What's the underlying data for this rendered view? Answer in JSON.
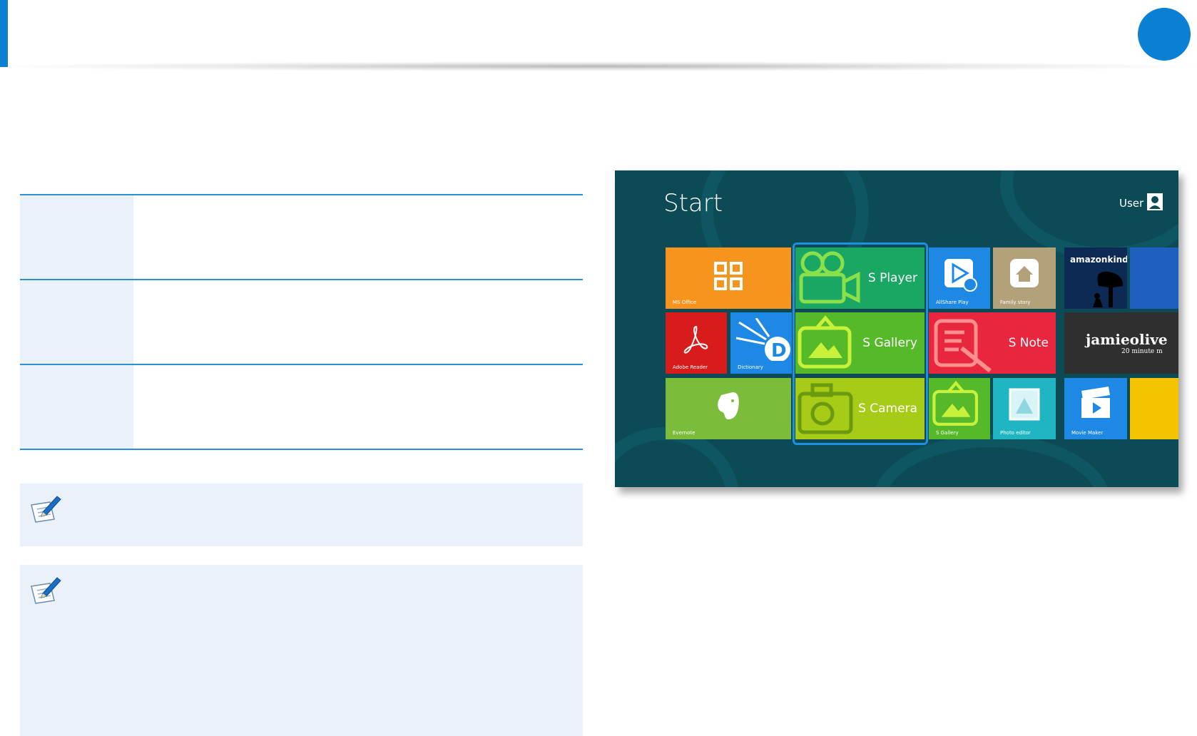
{
  "colors": {
    "accent": "#0a7fd4",
    "table_line": "#2b8fd6",
    "note_bg": "#eaf1f8",
    "start_bg": "#0c4a55"
  },
  "icons": {
    "note": "note-pencil-icon",
    "user": "user-icon"
  },
  "start_screen": {
    "title": "Start",
    "user": "User",
    "tiles": [
      {
        "label": "MS Office",
        "color": "#f7941d"
      },
      {
        "label": "S Player",
        "color": "#1aa763"
      },
      {
        "label": "AllShare Play",
        "color": "#1e88e5"
      },
      {
        "label": "Family story",
        "color": "#b3a17a"
      },
      {
        "label": "Adobe Reader",
        "color": "#d81c1c"
      },
      {
        "label": "Dictionary",
        "color": "#1e88e5"
      },
      {
        "label": "S Gallery",
        "color": "#55b92a"
      },
      {
        "label": "S Note",
        "color": "#e8263d"
      },
      {
        "label": "Evernote",
        "color": "#7cbc3b"
      },
      {
        "label": "S Camera",
        "color": "#a6cc17"
      },
      {
        "label": "S Gallery",
        "color": "#55b92a"
      },
      {
        "label": "Photo editor",
        "color": "#1fb5c3"
      },
      {
        "label": "amazonkindle",
        "color": "#0d2a55"
      },
      {
        "label": "jamieolive",
        "color": "#2f2f2f"
      },
      {
        "label": "20 minute m",
        "color": "#2f2f2f"
      },
      {
        "label": "Movie Maker",
        "color": "#1e88e5"
      }
    ]
  }
}
